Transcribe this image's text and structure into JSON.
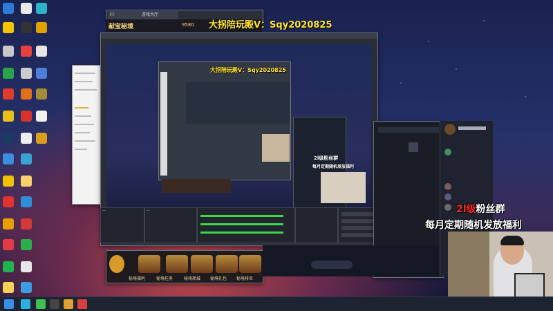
{
  "promo_text": "大拐陪玩殿V：Sqy2020825",
  "fans_line1_num": "2l级",
  "fans_line1_text": "粉丝群",
  "fans_line2": "每月定期随机发放福利",
  "game_header_title": "献宝秘境",
  "game_buttons": [
    "秘境福利",
    "秘境任务",
    "秘境商城",
    "秘境礼包",
    "秘境排名"
  ],
  "browser_tabs": [
    "FF",
    "游戏大厅"
  ],
  "gold_value": "9580",
  "nested_promo_1": "大拐陪玩殿V：Sqy2020825",
  "nested_fans_1": "2l级粉丝群",
  "nested_fans_2": "每月定期随机发放福利",
  "colors": {
    "promo": "#ffe52a",
    "fans_red": "#ff2a2a",
    "taskbar": "#1d2331"
  }
}
